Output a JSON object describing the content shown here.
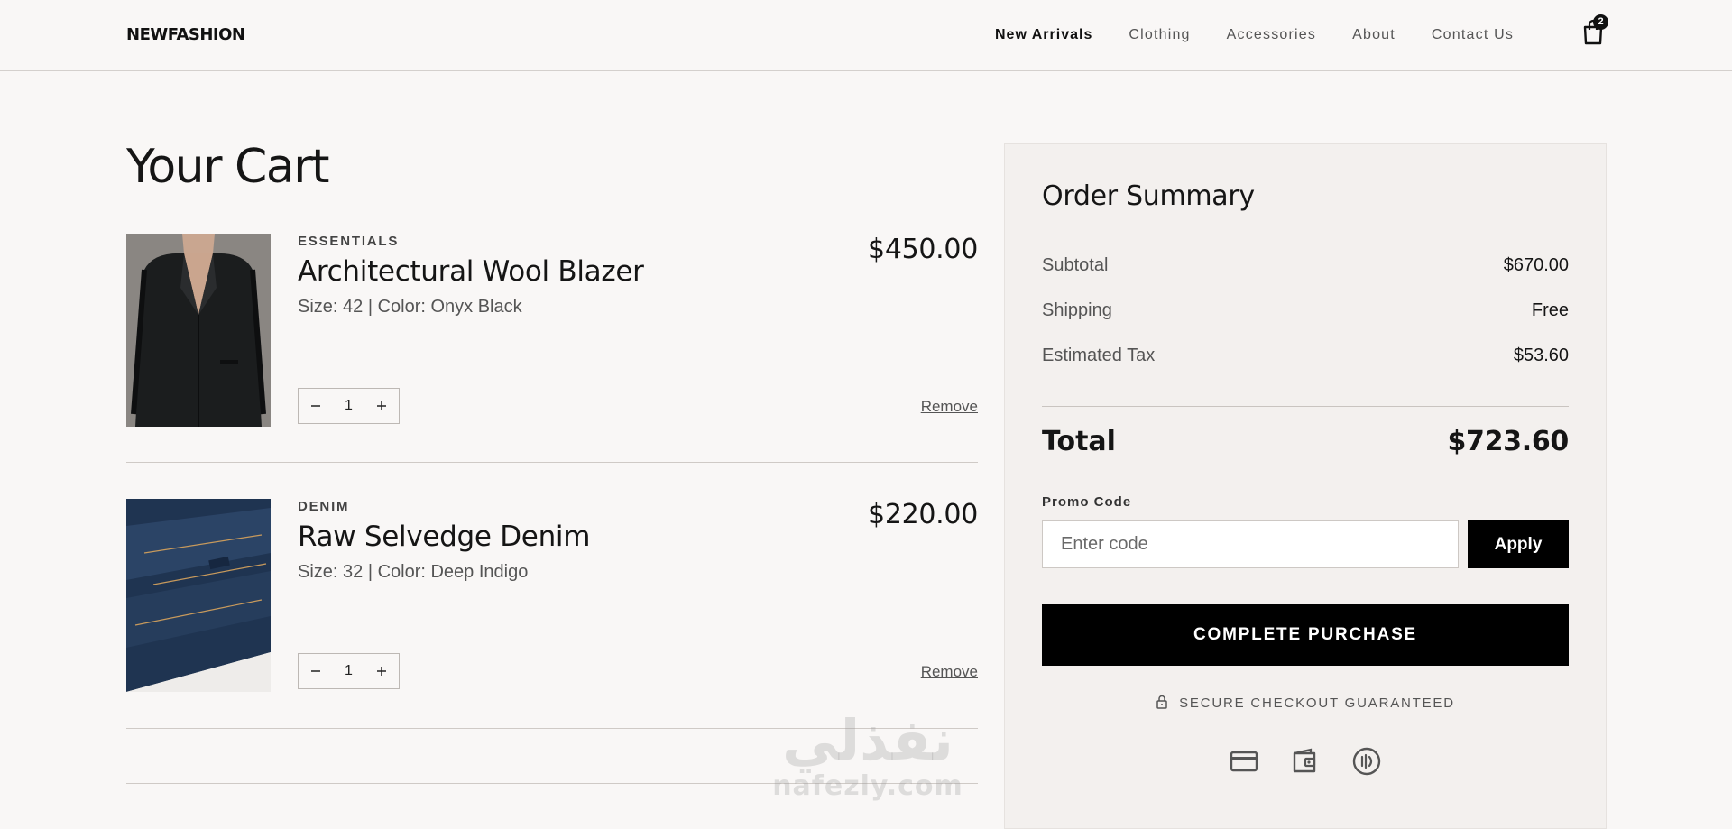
{
  "header": {
    "logo": "NEWFASHION",
    "nav": [
      "New Arrivals",
      "Clothing",
      "Accessories",
      "About",
      "Contact Us"
    ],
    "cart_count": "2",
    "icon": "shopping-bag-icon"
  },
  "cart": {
    "title": "Your Cart",
    "items": [
      {
        "category": "ESSENTIALS",
        "name": "Architectural Wool Blazer",
        "attributes": "Size: 42 | Color: Onyx Black",
        "price": "$450.00",
        "quantity": "1",
        "remove_label": "Remove",
        "image": "black-wool-blazer-photo"
      },
      {
        "category": "DENIM",
        "name": "Raw Selvedge Denim",
        "attributes": "Size: 32 | Color: Deep Indigo",
        "price": "$220.00",
        "quantity": "1",
        "remove_label": "Remove",
        "image": "folded-denim-jeans-photo"
      }
    ]
  },
  "summary": {
    "title": "Order Summary",
    "subtotal_label": "Subtotal",
    "subtotal_value": "$670.00",
    "shipping_label": "Shipping",
    "shipping_value": "Free",
    "tax_label": "Estimated Tax",
    "tax_value": "$53.60",
    "total_label": "Total",
    "total_value": "$723.60",
    "promo_label": "Promo Code",
    "promo_placeholder": "Enter code",
    "apply_label": "Apply",
    "purchase_label": "COMPLETE PURCHASE",
    "secure_text": "SECURE CHECKOUT GUARANTEED",
    "payment_icons": [
      "credit-card-icon",
      "wallet-icon",
      "contactless-icon"
    ]
  },
  "watermark": {
    "arabic": "نفذلي",
    "latin": "nafezly.com"
  },
  "colors": {
    "background": "#f9f7f6",
    "summary_background": "#f3f0ee",
    "primary_button": "#000000",
    "text": "#151515"
  }
}
